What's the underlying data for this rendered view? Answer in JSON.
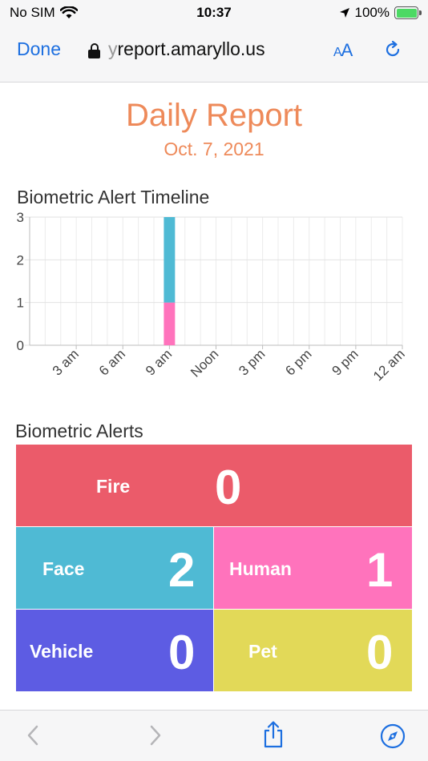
{
  "status_bar": {
    "carrier": "No SIM",
    "time": "10:37",
    "battery": "100%"
  },
  "browser": {
    "done_label": "Done",
    "url_prefix": "y",
    "url": "report.amaryllo.us",
    "text_size_label_small": "A",
    "text_size_label_large": "A"
  },
  "report": {
    "title": "Daily Report",
    "date": "Oct. 7, 2021"
  },
  "chart_title": "Biometric Alert Timeline",
  "chart_data": {
    "type": "bar",
    "stacked": true,
    "categories": [
      "3 am",
      "6 am",
      "9 am",
      "Noon",
      "3 pm",
      "6 pm",
      "9 pm",
      "12 am"
    ],
    "x_hours": [
      0,
      24
    ],
    "bars": [
      {
        "hour": 9,
        "segments": [
          {
            "value": 1,
            "color": "#ff73bc"
          },
          {
            "value": 2,
            "color": "#4fbad4"
          }
        ]
      }
    ],
    "y_ticks": [
      "0",
      "1",
      "2",
      "3"
    ],
    "ylim": [
      0,
      3
    ],
    "grid": true
  },
  "alerts_title": "Biometric Alerts",
  "alerts": {
    "fire": {
      "label": "Fire",
      "count": "0",
      "color": "#eb5b6a"
    },
    "face": {
      "label": "Face",
      "count": "2",
      "color": "#4fbad4"
    },
    "human": {
      "label": "Human",
      "count": "1",
      "color": "#ff73bc"
    },
    "vehicle": {
      "label": "Vehicle",
      "count": "0",
      "color": "#5d5ce3"
    },
    "pet": {
      "label": "Pet",
      "count": "0",
      "color": "#e2d958"
    }
  },
  "colors": {
    "accent": "#1d6fe0",
    "title": "#ee8a5a"
  },
  "icons": {
    "back": "chevron-left-icon",
    "forward": "chevron-right-icon",
    "share": "share-icon",
    "compass": "compass-icon",
    "reload": "reload-icon",
    "lock": "lock-icon",
    "wifi": "wifi-icon",
    "location": "location-arrow-icon",
    "battery": "battery-icon"
  }
}
